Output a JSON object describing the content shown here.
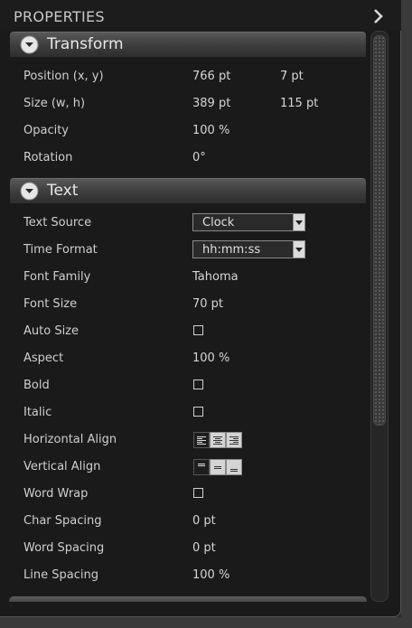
{
  "panel": {
    "title": "PROPERTIES"
  },
  "transform": {
    "title": "Transform",
    "position": {
      "label": "Position (x, y)",
      "x": "766 pt",
      "y": "7 pt"
    },
    "size": {
      "label": "Size (w, h)",
      "w": "389 pt",
      "h": "115 pt"
    },
    "opacity": {
      "label": "Opacity",
      "value": "100 %"
    },
    "rotation": {
      "label": "Rotation",
      "value": "0°"
    }
  },
  "text": {
    "title": "Text",
    "text_source": {
      "label": "Text Source",
      "value": "Clock"
    },
    "time_format": {
      "label": "Time Format",
      "value": "hh:mm:ss"
    },
    "font_family": {
      "label": "Font Family",
      "value": "Tahoma"
    },
    "font_size": {
      "label": "Font Size",
      "value": "70 pt"
    },
    "auto_size": {
      "label": "Auto Size",
      "checked": false
    },
    "aspect": {
      "label": "Aspect",
      "value": "100 %"
    },
    "bold": {
      "label": "Bold",
      "checked": false
    },
    "italic": {
      "label": "Italic",
      "checked": false
    },
    "horizontal_align": {
      "label": "Horizontal Align",
      "selected": "left"
    },
    "vertical_align": {
      "label": "Vertical Align",
      "selected": "top"
    },
    "word_wrap": {
      "label": "Word Wrap",
      "checked": false
    },
    "char_spacing": {
      "label": "Char Spacing",
      "value": "0 pt"
    },
    "word_spacing": {
      "label": "Word Spacing",
      "value": "0 pt"
    },
    "line_spacing": {
      "label": "Line Spacing",
      "value": "100 %"
    }
  },
  "icons": {
    "collapse": "chevron-right-icon",
    "section_toggle": "circle-chevron-down-icon",
    "dropdown": "triangle-down-icon"
  }
}
